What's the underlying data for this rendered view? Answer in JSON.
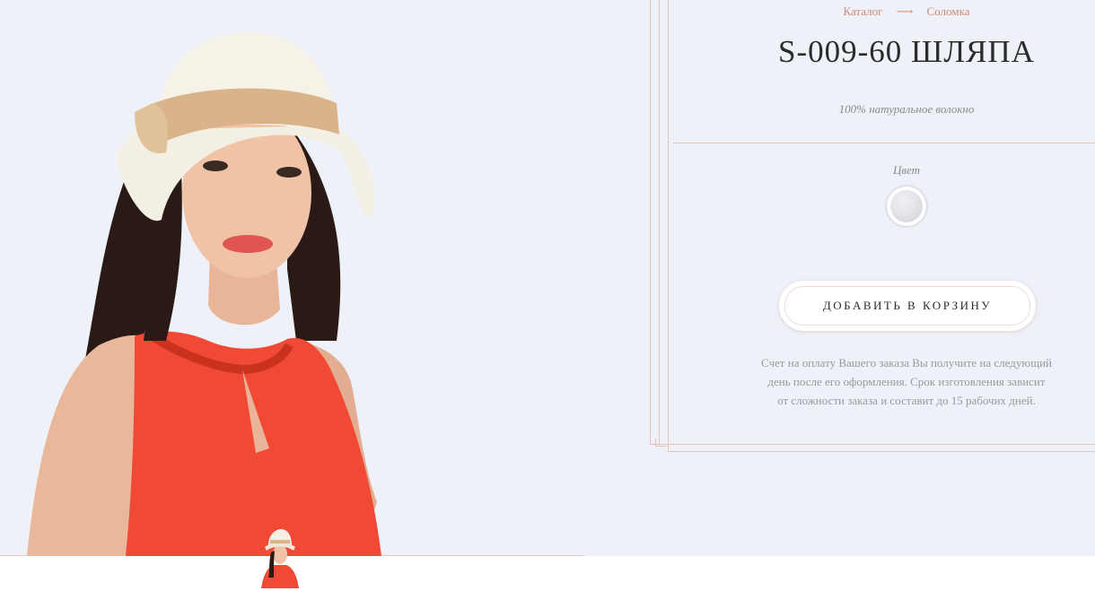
{
  "breadcrumb": {
    "catalog": "Каталог",
    "separator": "⟶",
    "current": "Соломка"
  },
  "product": {
    "title": "S-009-60 ШЛЯПА",
    "material": "100% натуральное волокно",
    "color_label": "Цвет",
    "selected_color": "#dcdbe0"
  },
  "actions": {
    "add_to_cart": "ДОБАВИТЬ В КОРЗИНУ"
  },
  "payment_note": {
    "line1": "Счет на оплату Вашего заказа Вы получите на следующий",
    "line2": "день после его оформления. Срок изготовления зависит",
    "line3": "от сложности заказа и составит до 15 рабочих дней."
  },
  "colors": {
    "accent": "#d08a77",
    "background": "#eef1f8",
    "frame": "#e3c3bb",
    "dress": "#f04a36",
    "hat": "#f3efe4"
  }
}
